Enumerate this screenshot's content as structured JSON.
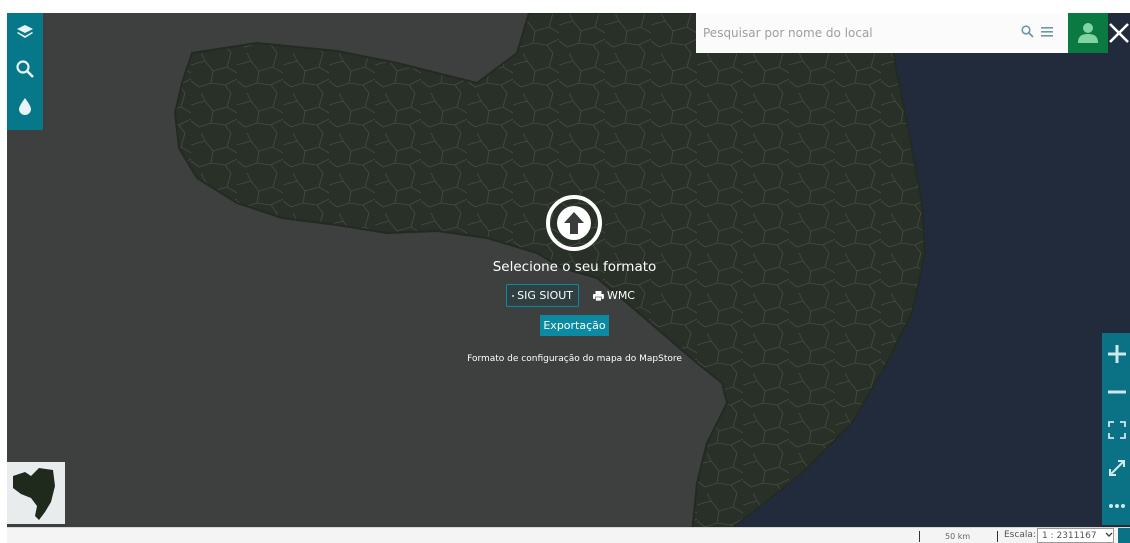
{
  "search": {
    "placeholder": "Pesquisar por nome do local"
  },
  "toolbar_left": {
    "icons": [
      "layers-icon",
      "search-icon",
      "drop-icon"
    ]
  },
  "dialog": {
    "title": "Selecione o seu formato",
    "formats": [
      {
        "label": "SIG SIOUT",
        "selected": true
      },
      {
        "label": "WMC",
        "selected": false
      }
    ],
    "export_label": "Exportação",
    "description": "Formato de configuração do mapa do MapStore"
  },
  "toolbar_right": {
    "icons": [
      "zoom-in-icon",
      "zoom-out-icon",
      "zoom-to-extent-icon",
      "fullscreen-icon",
      "more-icon"
    ]
  },
  "footer": {
    "scale_distance": "50 km",
    "scale_label": "Escala:",
    "scale_value": "1 : 2311167"
  },
  "colors": {
    "accent": "#07778a",
    "user_button": "#0b7a42",
    "overlay": "#3a3c3c"
  }
}
